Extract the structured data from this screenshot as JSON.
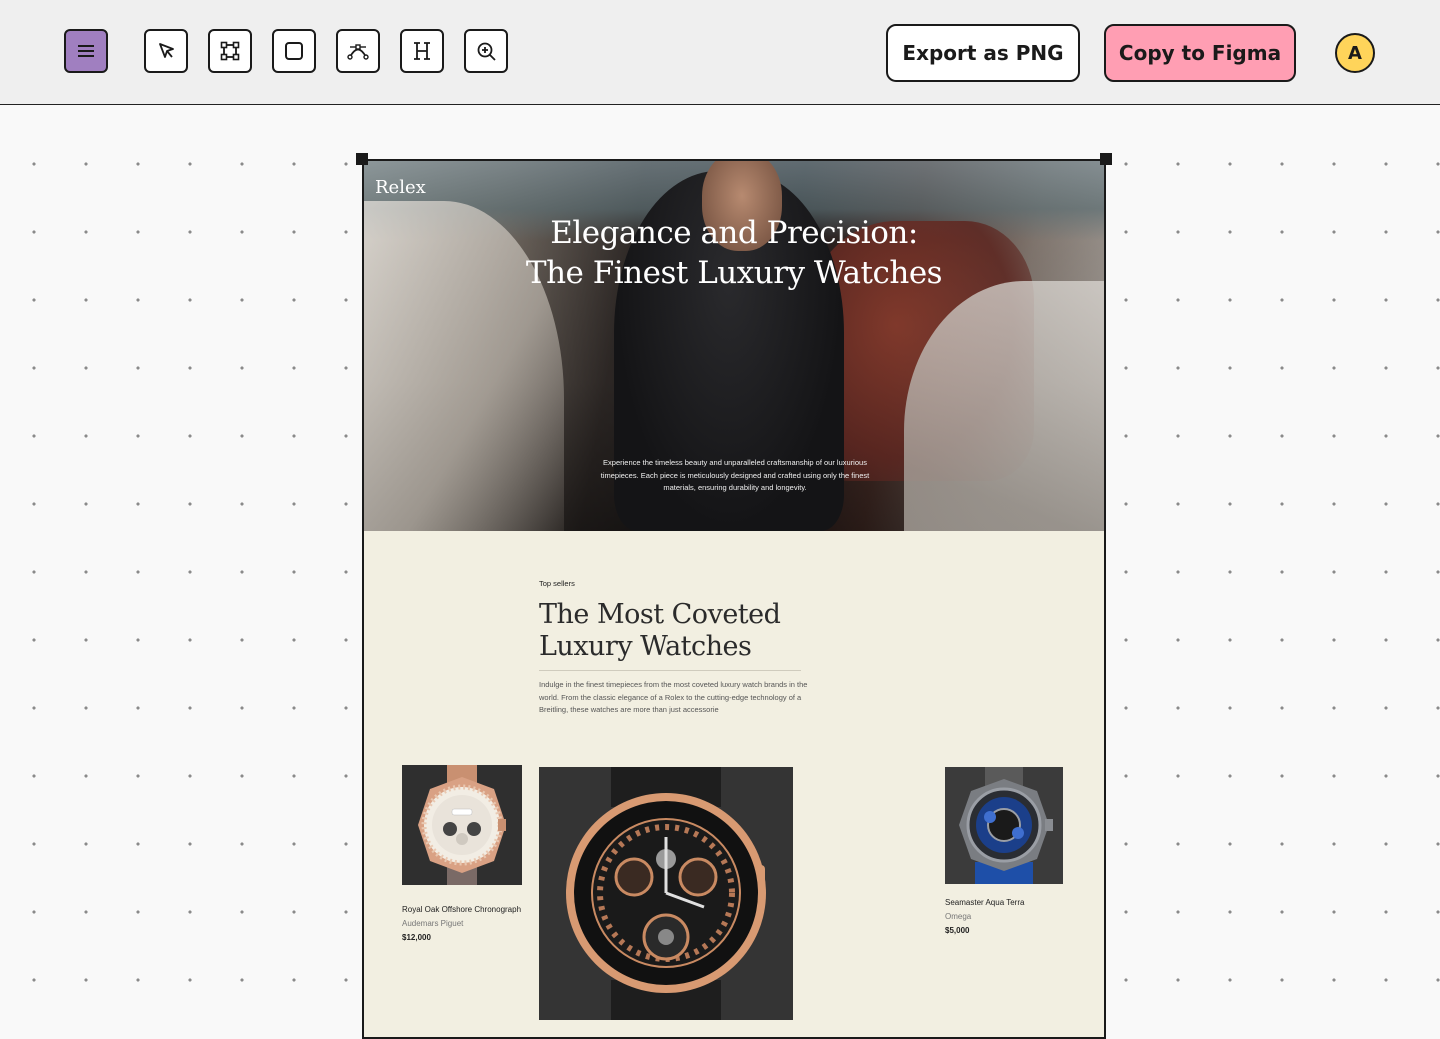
{
  "toolbar": {
    "tools": [
      {
        "name": "menu-icon"
      },
      {
        "name": "select-cursor-icon"
      },
      {
        "name": "frame-icon"
      },
      {
        "name": "rectangle-icon"
      },
      {
        "name": "pen-path-icon"
      },
      {
        "name": "text-heading-icon"
      },
      {
        "name": "zoom-in-icon"
      }
    ],
    "export_label": "Export as PNG",
    "figma_label": "Copy to Figma",
    "avatar_initial": "A"
  },
  "colors": {
    "menu_accent": "#a07fc0",
    "figma_button": "#ff9eb3",
    "avatar": "#ffd45a",
    "section_bg": "#f2efe1"
  },
  "artboard": {
    "hero": {
      "brand": "Relex",
      "title_line1": "Elegance and Precision:",
      "title_line2": "The Finest Luxury Watches",
      "description": "Experience the timeless beauty and unparalleled craftsmanship of our luxurious timepieces. Each piece is meticulously designed and crafted using only the finest materials, ensuring durability and longevity."
    },
    "top_sellers": {
      "eyebrow": "Top sellers",
      "title_line1": "The Most Coveted",
      "title_line2": "Luxury Watches",
      "description": "Indulge in the finest timepieces from the most coveted luxury watch brands in the world. From the classic elegance of a Rolex to the cutting-edge technology of a Breitling, these watches are more than just accessorie"
    },
    "products": [
      {
        "name": "Royal Oak Offshore Chronograph",
        "brand": "Audemars Piguet",
        "price": "$12,000"
      },
      {
        "name": "Seamaster Aqua Terra",
        "brand": "Omega",
        "price": "$5,000"
      }
    ]
  }
}
